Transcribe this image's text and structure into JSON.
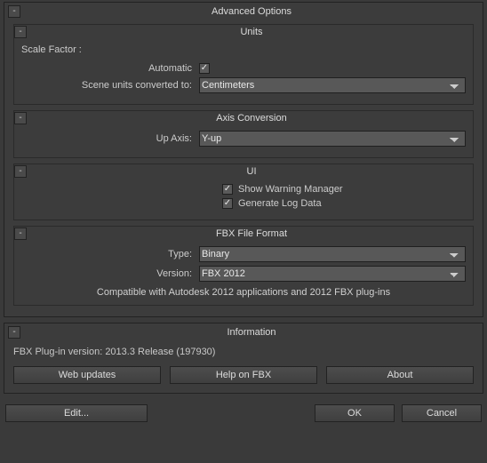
{
  "panel": {
    "title": "Advanced Options",
    "collapse": "-"
  },
  "units": {
    "title": "Units",
    "collapse": "-",
    "scale_factor_label": "Scale Factor :",
    "automatic_label": "Automatic",
    "automatic_checked": true,
    "converted_label": "Scene units converted to:",
    "converted_value": "Centimeters"
  },
  "axis": {
    "title": "Axis Conversion",
    "collapse": "-",
    "up_axis_label": "Up Axis:",
    "up_axis_value": "Y-up"
  },
  "ui": {
    "title": "UI",
    "collapse": "-",
    "show_warning_label": "Show Warning Manager",
    "show_warning_checked": true,
    "generate_log_label": "Generate Log Data",
    "generate_log_checked": true
  },
  "fbx": {
    "title": "FBX File Format",
    "collapse": "-",
    "type_label": "Type:",
    "type_value": "Binary",
    "version_label": "Version:",
    "version_value": "FBX 2012",
    "compat_text": "Compatible with Autodesk 2012 applications and 2012 FBX plug-ins"
  },
  "info": {
    "title": "Information",
    "collapse": "-",
    "plugin_text": "FBX Plug-in version: 2013.3 Release (197930)",
    "web_updates": "Web updates",
    "help": "Help on FBX",
    "about": "About"
  },
  "buttons": {
    "edit": "Edit...",
    "ok": "OK",
    "cancel": "Cancel"
  }
}
